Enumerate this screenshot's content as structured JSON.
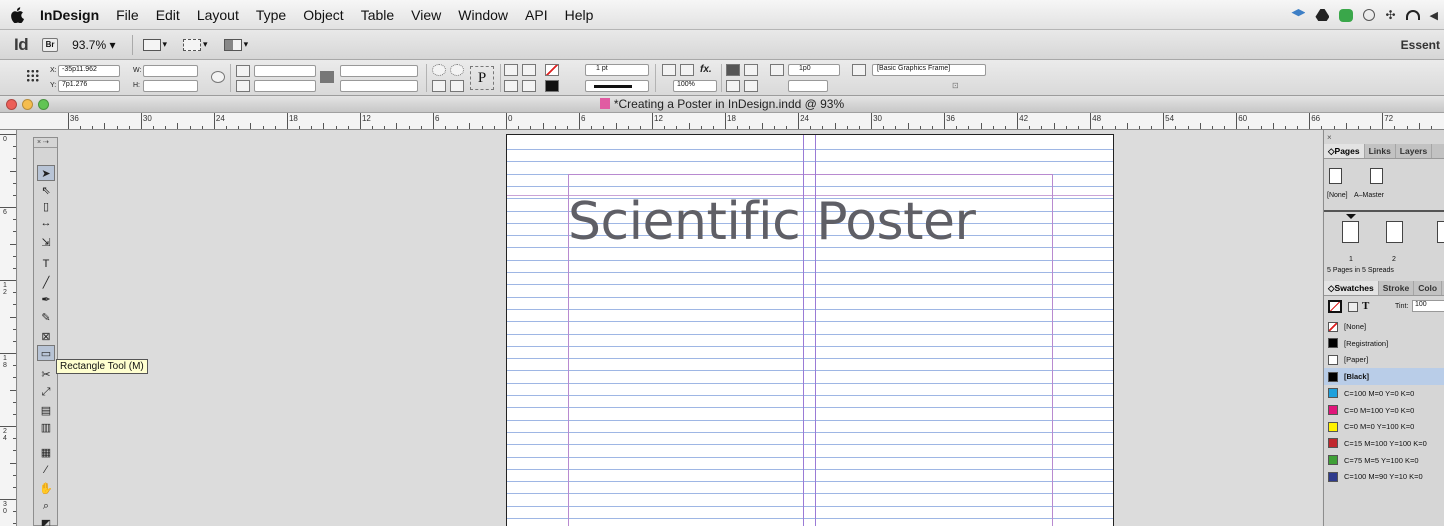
{
  "menubar": {
    "app_name": "InDesign",
    "items": [
      "File",
      "Edit",
      "Layout",
      "Type",
      "Object",
      "Table",
      "View",
      "Window",
      "API",
      "Help"
    ]
  },
  "appbar": {
    "logo": "Id",
    "bridge": "Br",
    "zoom": "93.7% ▾",
    "workspace": "Essent"
  },
  "control": {
    "x_label": "X:",
    "x_value": "-35p11.962",
    "y_label": "Y:",
    "y_value": "7p1.276",
    "w_label": "W:",
    "h_label": "H:",
    "stroke_weight": "1 pt",
    "scale": "100%",
    "text_inset": "1p0",
    "object_style": "[Basic Graphics Frame]",
    "fx": "fx."
  },
  "document": {
    "title": "*Creating a Poster in InDesign.indd @ 93%",
    "poster_title": "Scientific Poster"
  },
  "rulers": {
    "horizontal": [
      "36",
      "30",
      "24",
      "18",
      "12",
      "6",
      "0",
      "6",
      "12",
      "18",
      "24",
      "30",
      "36",
      "42",
      "48",
      "54",
      "60",
      "66",
      "72"
    ],
    "vertical": [
      "0",
      "6",
      "1 2",
      "1 8",
      "2 4",
      "3 0"
    ]
  },
  "tools": {
    "tooltip": "Rectangle Tool (M)"
  },
  "pages_panel": {
    "tabs": [
      "◇Pages",
      "Links",
      "Layers"
    ],
    "masters": [
      "[None]",
      "A–Master"
    ],
    "page_numbers": [
      "1",
      "2"
    ],
    "status": "5 Pages in 5 Spreads"
  },
  "swatches_panel": {
    "tabs": [
      "◇Swatches",
      "Stroke",
      "Colo"
    ],
    "tint_label": "Tint:",
    "tint_value": "100",
    "swatches": [
      {
        "name": "[None]",
        "color": "#ffffff",
        "selected": false
      },
      {
        "name": "[Registration]",
        "color": "#000000",
        "selected": false
      },
      {
        "name": "[Paper]",
        "color": "#ffffff",
        "selected": false
      },
      {
        "name": "[Black]",
        "color": "#000000",
        "selected": true
      },
      {
        "name": "C=100 M=0 Y=0 K=0",
        "color": "#1ea0dc",
        "selected": false
      },
      {
        "name": "C=0 M=100 Y=0 K=0",
        "color": "#e0157a",
        "selected": false
      },
      {
        "name": "C=0 M=0 Y=100 K=0",
        "color": "#fff200",
        "selected": false
      },
      {
        "name": "C=15 M=100 Y=100 K=0",
        "color": "#c0272d",
        "selected": false
      },
      {
        "name": "C=75 M=5 Y=100 K=0",
        "color": "#3fa037",
        "selected": false
      },
      {
        "name": "C=100 M=90 Y=10 K=0",
        "color": "#2e3a8c",
        "selected": false
      }
    ]
  }
}
